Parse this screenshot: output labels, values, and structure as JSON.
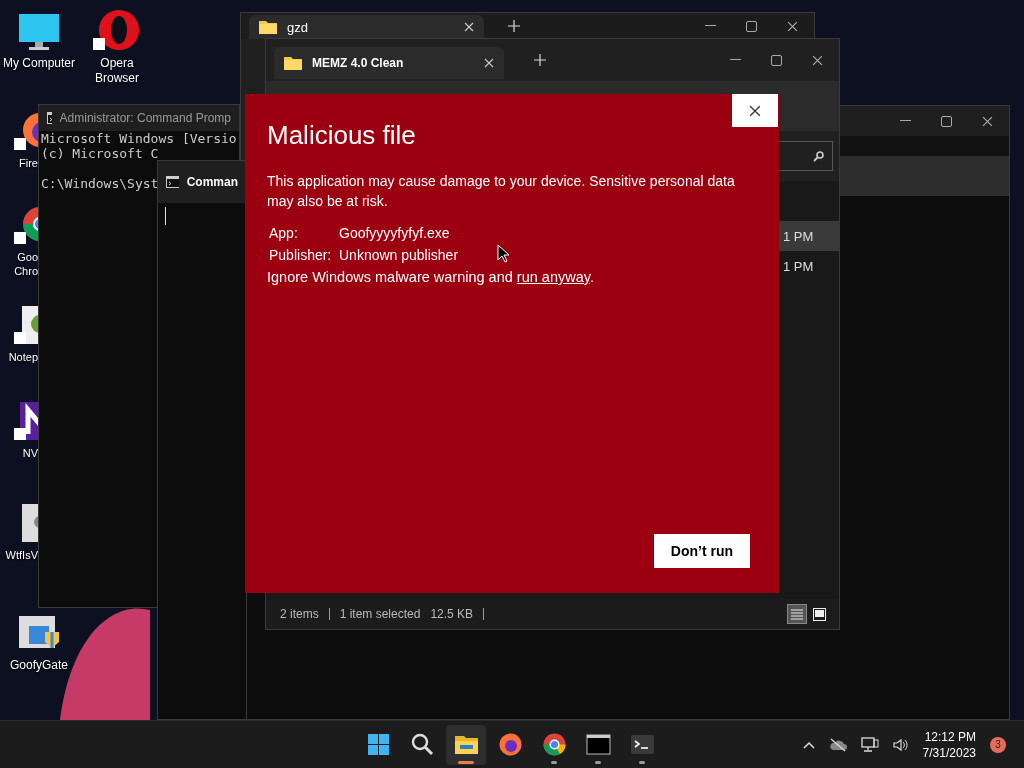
{
  "desktop_icons": [
    {
      "kind": "monitor",
      "label": "My Computer"
    },
    {
      "kind": "opera",
      "label": "Opera Browser"
    },
    {
      "kind": "firefox",
      "label": "Fire"
    },
    {
      "kind": "chrome",
      "label": "Goo Chro"
    },
    {
      "kind": "notepad",
      "label": "Notep"
    },
    {
      "kind": "nv",
      "label": "NV"
    },
    {
      "kind": "settings",
      "label": "WtfIsV"
    },
    {
      "kind": "installer",
      "label": "GoofyGate"
    }
  ],
  "admin_console": {
    "title": "Administrator: Command Promp",
    "lines": [
      "Microsoft Windows [Versio",
      "(c) Microsoft C",
      "C:\\Windows\\Syst"
    ]
  },
  "console": {
    "title": "Comman"
  },
  "back_explorer": {
    "tab": "gzd"
  },
  "explorer": {
    "tab": "MEMZ 4.0 Clean",
    "rows": [
      {
        "time": "1 PM",
        "selected": true
      },
      {
        "time": "1 PM",
        "selected": false
      }
    ],
    "status": [
      "2 items",
      "1 item selected",
      "12.5 KB"
    ],
    "views": [
      {
        "kind": "details",
        "selected": true
      },
      {
        "kind": "tiles",
        "selected": false
      }
    ]
  },
  "dialog": {
    "title": "Malicious file",
    "message": "This application may cause damage to your device. Sensitive personal data may also be at risk.",
    "fields": [
      {
        "label": "App:",
        "value": "Goofyyyyfyfyf.exe"
      },
      {
        "label": "Publisher:",
        "value": "Unknown publisher"
      }
    ],
    "warning": {
      "before": "Ignore Windows malware warning and ",
      "link": "run anyway",
      "after": "."
    },
    "button": "Don’t run"
  },
  "taskbar": {
    "items": [
      {
        "kind": "start",
        "selected": false,
        "running": false
      },
      {
        "kind": "search",
        "selected": false,
        "running": false
      },
      {
        "kind": "explorer",
        "selected": true,
        "running": true
      },
      {
        "kind": "firefox",
        "selected": false,
        "running": false
      },
      {
        "kind": "chrome",
        "selected": false,
        "running": true
      },
      {
        "kind": "console",
        "selected": false,
        "running": true
      },
      {
        "kind": "terminal",
        "selected": false,
        "running": true
      }
    ],
    "time": "12:12 PM",
    "date": "7/31/2023",
    "badge": "3"
  }
}
